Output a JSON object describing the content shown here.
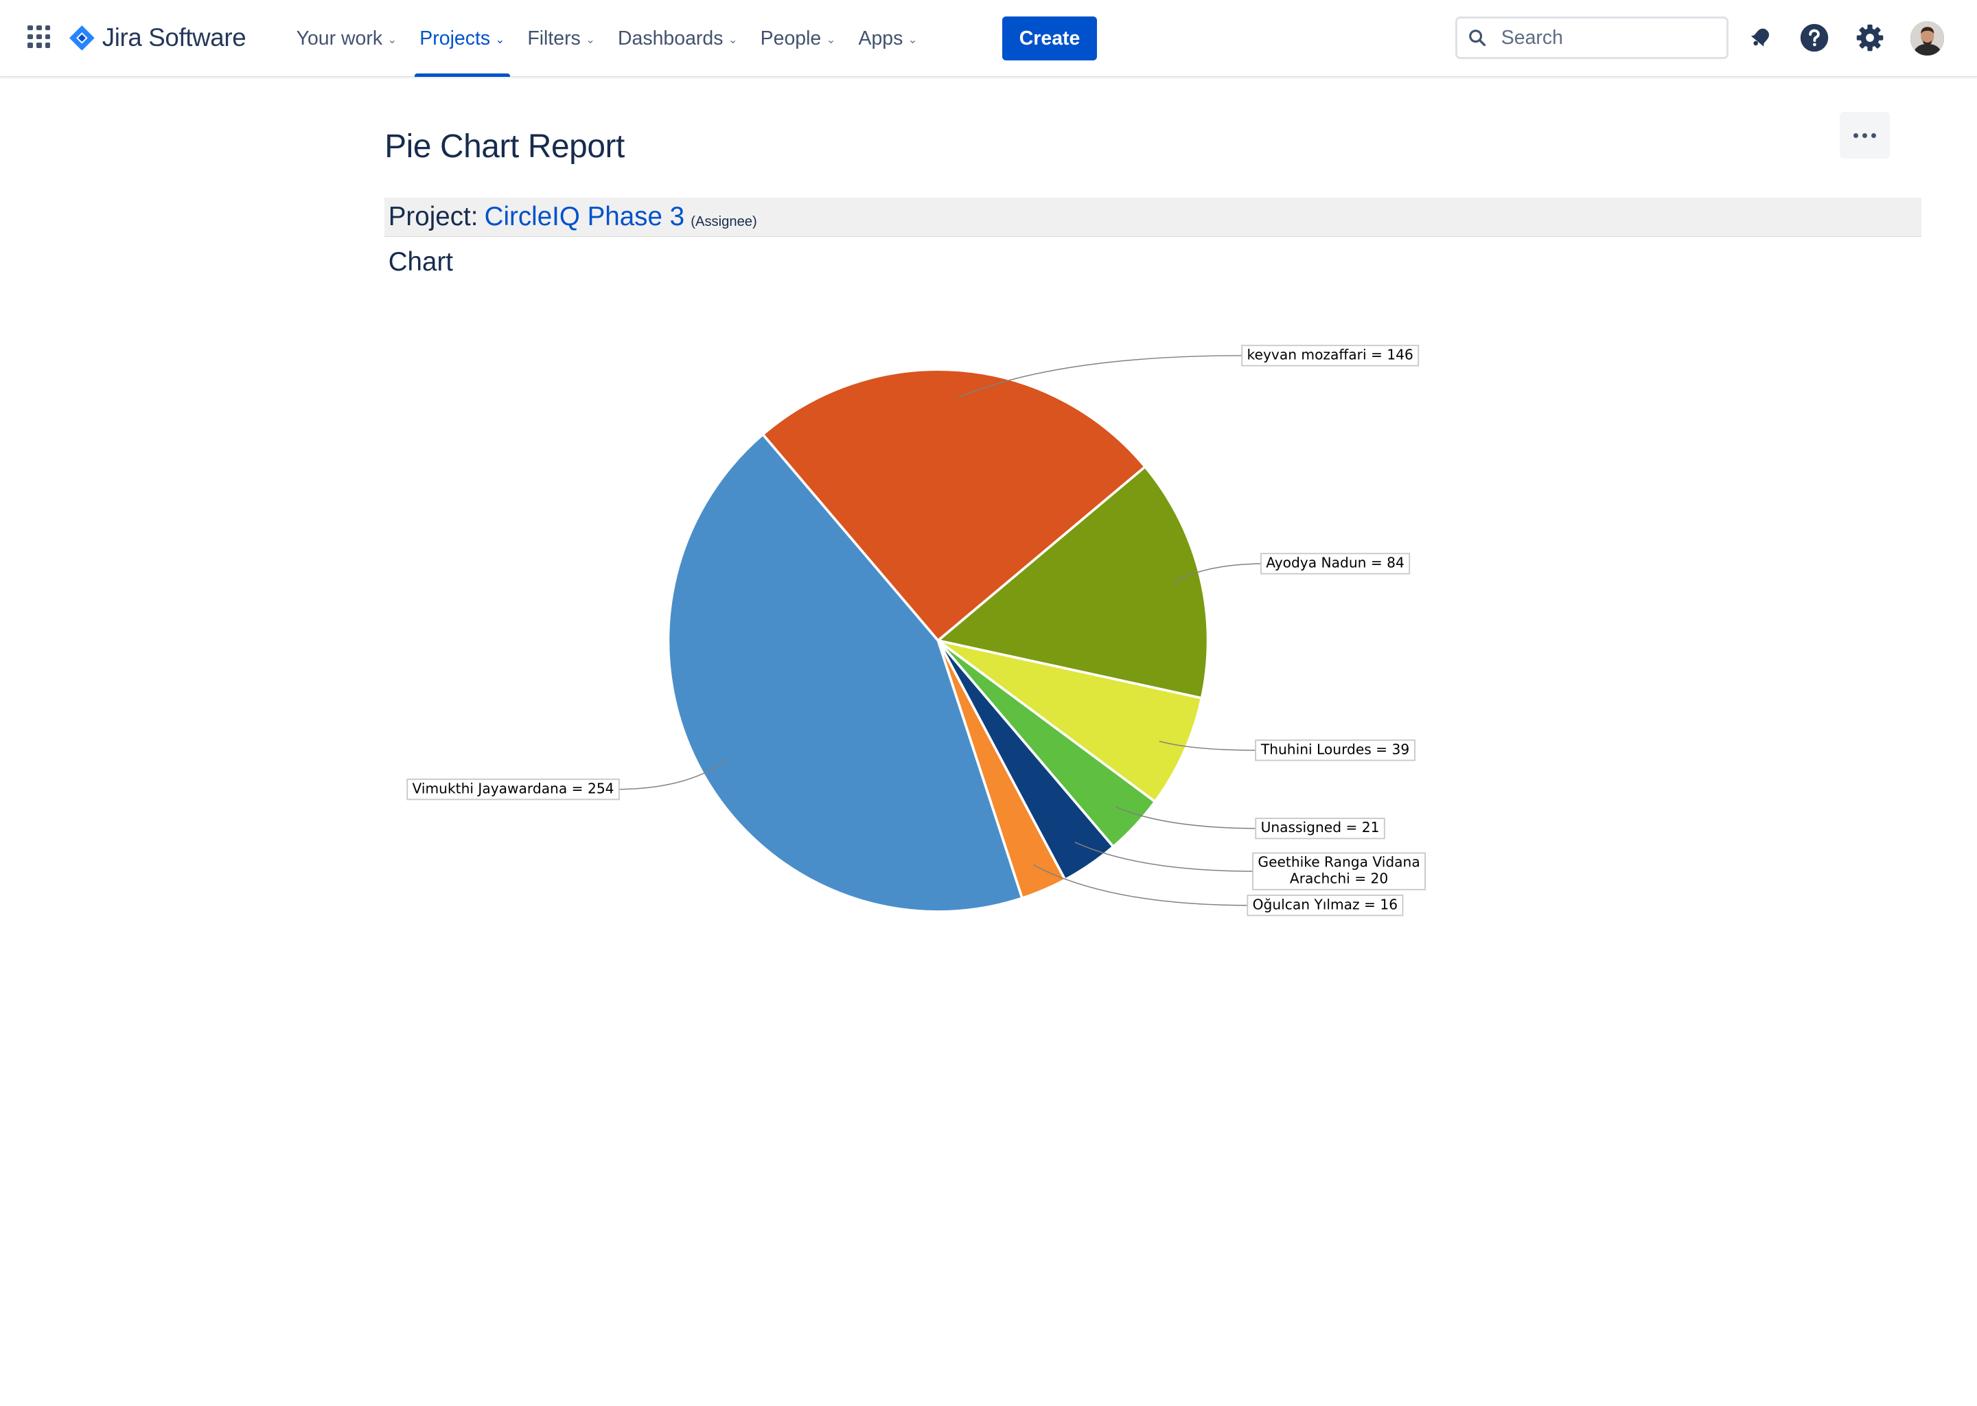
{
  "app": {
    "name": "Jira Software"
  },
  "nav": {
    "items": [
      {
        "label": "Your work",
        "active": false
      },
      {
        "label": "Projects",
        "active": true
      },
      {
        "label": "Filters",
        "active": false
      },
      {
        "label": "Dashboards",
        "active": false
      },
      {
        "label": "People",
        "active": false
      },
      {
        "label": "Apps",
        "active": false
      }
    ],
    "create_label": "Create"
  },
  "search": {
    "placeholder": "Search"
  },
  "toolbar_icons": [
    "notifications-icon",
    "help-icon",
    "settings-icon",
    "profile-avatar"
  ],
  "page": {
    "title": "Pie Chart Report",
    "project_prefix": "Project:",
    "project_name": "CircleIQ Phase 3",
    "statistic_type": "(Assignee)",
    "chart_heading": "Chart"
  },
  "colors": {
    "accent": "#0052cc",
    "text": "#172b4d"
  },
  "chart_data": {
    "type": "pie",
    "title": "",
    "slices": [
      {
        "label": "keyvan mozaffari = 146",
        "name": "keyvan mozaffari",
        "value": 146,
        "color": "#d9541e"
      },
      {
        "label": "Ayodya Nadun = 84",
        "name": "Ayodya Nadun",
        "value": 84,
        "color": "#7a9a12"
      },
      {
        "label": "Thuhini Lourdes = 39",
        "name": "Thuhini Lourdes",
        "value": 39,
        "color": "#dfe63c"
      },
      {
        "label": "Unassigned = 21",
        "name": "Unassigned",
        "value": 21,
        "color": "#5ebf41"
      },
      {
        "label": "Geethike Ranga Vidana Arachchi = 20",
        "label_lines": [
          "Geethike Ranga Vidana",
          "Arachchi = 20"
        ],
        "name": "Geethike Ranga Vidana Arachchi",
        "value": 20,
        "color": "#0d3f7e"
      },
      {
        "label": "Oğulcan Yılmaz = 16",
        "name": "Oğulcan Yılmaz",
        "value": 16,
        "color": "#f58a2e"
      },
      {
        "label": "Vimukthi Jayawardana = 254",
        "name": "Vimukthi Jayawardana",
        "value": 254,
        "color": "#4a8ec9"
      }
    ]
  }
}
